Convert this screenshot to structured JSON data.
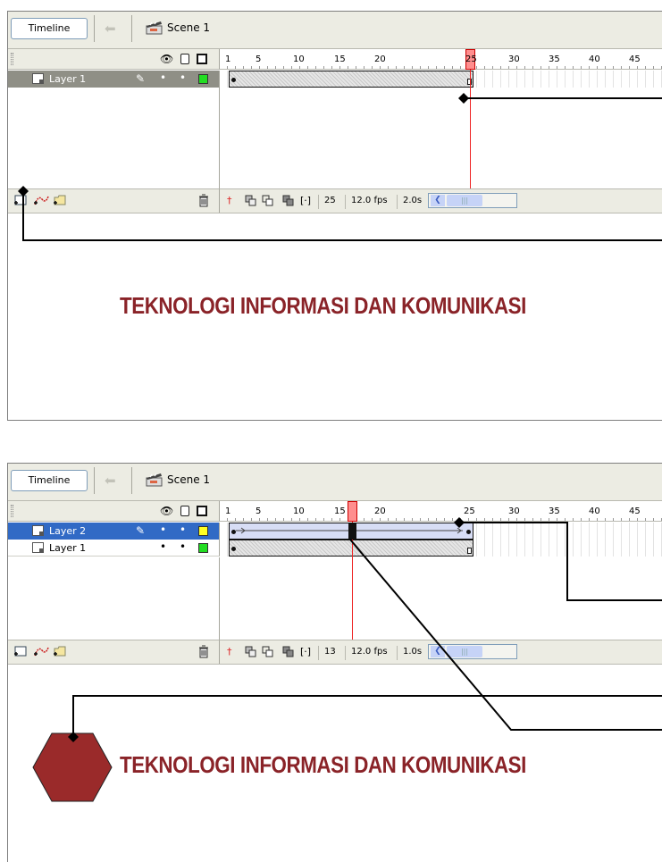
{
  "colors": {
    "frame_bg": "#ecece3",
    "selected_layer_grey": "#8f8f86",
    "selected_layer_blue": "#316ac5",
    "playhead": "#ff8e8e",
    "stage_text": "#8a2328",
    "hexagon": "#9a2a2a",
    "layer1_swatch": "#22dd22",
    "layer2_swatch": "#ffff22"
  },
  "panel1": {
    "toolbar": {
      "timeline_button": "Timeline",
      "back_icon": "back-arrow-icon",
      "scene_label": "Scene 1"
    },
    "ruler_ticks": [
      "1",
      "5",
      "10",
      "15",
      "20",
      "25",
      "30",
      "35",
      "40",
      "45"
    ],
    "playhead_frame": 25,
    "layers": [
      {
        "name": "Layer 1",
        "swatch": "#22dd22",
        "selected": true
      }
    ],
    "footer": {
      "current_frame": "25",
      "fps": "12.0 fps",
      "time": "2.0s"
    },
    "stage_text": "TEKNOLOGI INFORMASI DAN KOMUNIKASI"
  },
  "panel2": {
    "toolbar": {
      "timeline_button": "Timeline",
      "back_icon": "back-arrow-icon",
      "scene_label": "Scene 1"
    },
    "ruler_ticks": [
      "1",
      "5",
      "10",
      "15",
      "20",
      "25",
      "30",
      "35",
      "40",
      "45"
    ],
    "playhead_frame": 13,
    "layers": [
      {
        "name": "Layer 2",
        "swatch": "#ffff22",
        "selected": true
      },
      {
        "name": "Layer 1",
        "swatch": "#22dd22",
        "selected": false
      }
    ],
    "footer": {
      "current_frame": "13",
      "fps": "12.0 fps",
      "time": "1.0s"
    },
    "stage_text": "TEKNOLOGI INFORMASI DAN KOMUNIKASI"
  }
}
